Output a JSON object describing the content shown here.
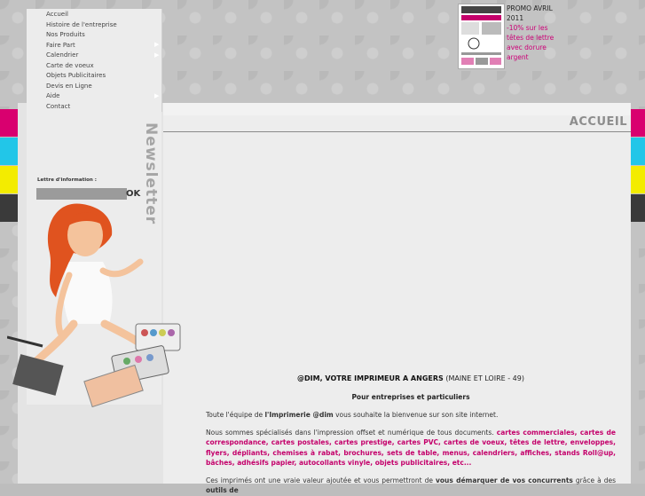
{
  "menu": {
    "items": [
      {
        "label": "Accueil",
        "has_submenu": false
      },
      {
        "label": "Histoire de l'entreprise",
        "has_submenu": false
      },
      {
        "label": "Nos Produits",
        "has_submenu": false
      },
      {
        "label": "Faire Part",
        "has_submenu": true
      },
      {
        "label": "Calendrier",
        "has_submenu": true
      },
      {
        "label": "Carte de voeux",
        "has_submenu": false
      },
      {
        "label": "Objets Publicitaires",
        "has_submenu": false
      },
      {
        "label": "Devis en Ligne",
        "has_submenu": false
      },
      {
        "label": "Aide",
        "has_submenu": true
      },
      {
        "label": "Contact",
        "has_submenu": false
      }
    ]
  },
  "promo": {
    "title": "PROMO AVRIL 2011",
    "description": "-10% sur les têtes de lettre avec dorure argent"
  },
  "newsletter": {
    "heading": "Newsletter",
    "label": "Lettre d'information :",
    "input_value": "",
    "ok_label": "OK"
  },
  "page": {
    "title": "ACCUEIL"
  },
  "content": {
    "heading_main": "@DIM, VOTRE IMPRIMEUR A ANGERS",
    "heading_loc": "(MAINE ET LOIRE - 49)",
    "subheading": "Pour entreprises et particuliers",
    "welcome_pre": "Toute l'équipe de ",
    "welcome_bold": "l'Imprimerie @dim",
    "welcome_post": " vous souhaite la bienvenue sur son site internet.",
    "services_pre": "Nous sommes spécialisés dans l'impression offset et numérique de tous documents. ",
    "services_list": "cartes commerciales, cartes de correspondance, cartes postales, cartes prestige, cartes PVC, cartes de voeux, têtes de lettre, enveloppes, flyers, dépliants, chemises à rabat, brochures, sets de table, menus, calendriers, affiches, stands Roll@up, bâches, adhésifs papier, autocollants vinyle, objets publicitaires, etc...",
    "last_pre": "Ces imprimés ont une vraie valeur ajoutée et vous permettront de ",
    "last_bold": "vous démarquer de vos concurrents",
    "last_mid": " grâce à des ",
    "last_bold2": "outils de"
  },
  "colors": {
    "accent": "#c4006b",
    "stripe_pink": "#d9006f",
    "stripe_cyan": "#22c6e8",
    "stripe_yellow": "#f3ec00",
    "stripe_dark": "#3a3a3a"
  }
}
